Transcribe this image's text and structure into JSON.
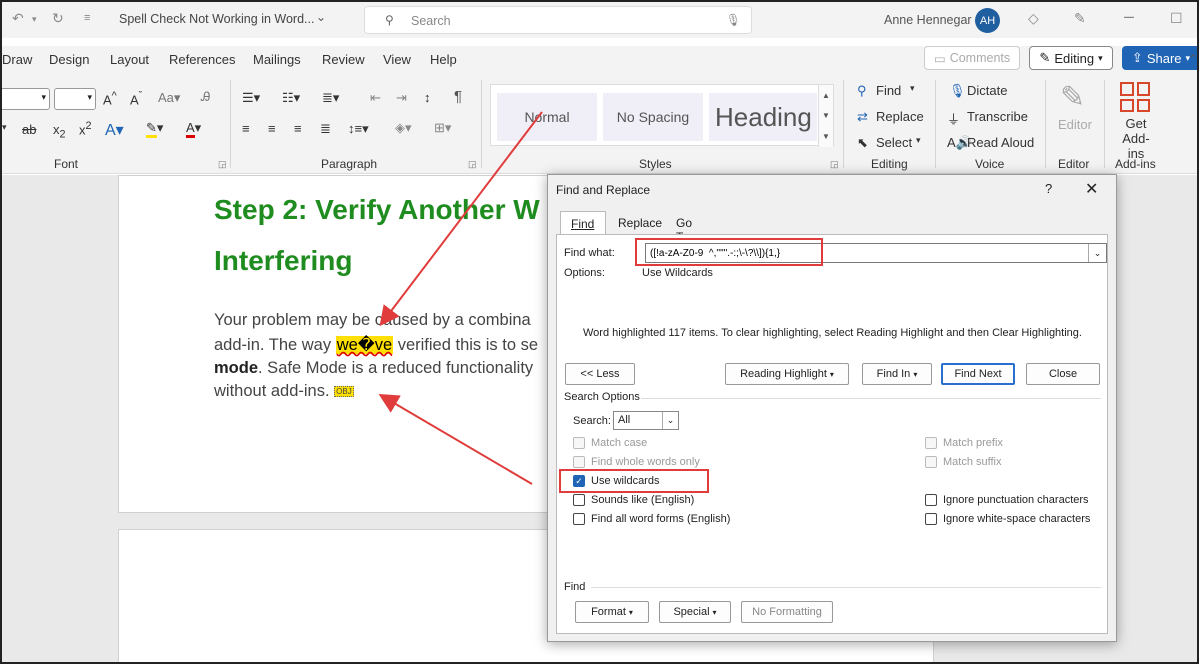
{
  "titlebar": {
    "doc_title": "Spell Check Not Working in Word...",
    "search_placeholder": "Search",
    "user_name": "Anne Hennegar",
    "avatar_initials": "AH"
  },
  "menu": {
    "items": [
      "Draw",
      "Design",
      "Layout",
      "References",
      "Mailings",
      "Review",
      "View",
      "Help"
    ],
    "comments": "Comments",
    "editing": "Editing",
    "share": "Share"
  },
  "ribbon": {
    "groups": {
      "font": "Font",
      "paragraph": "Paragraph",
      "styles": "Styles",
      "editing": "Editing",
      "voice": "Voice",
      "editor": "Editor",
      "addins": "Add-ins"
    },
    "styles": [
      "Normal",
      "No Spacing",
      "Heading"
    ],
    "find": "Find",
    "replace": "Replace",
    "select": "Select",
    "dictate": "Dictate",
    "transcribe": "Transcribe",
    "read_aloud": "Read Aloud",
    "editor_btn": "Editor",
    "get_addins": "Get Add-ins"
  },
  "document": {
    "heading_line1": "Step 2: Verify Another W",
    "heading_line2": "Interfering",
    "p_line1": "Your problem may be caused by a combina",
    "p_line2_a": "add-in. The way ",
    "p_line2_bad": "we�ve",
    "p_line2_b": " verified this is to se",
    "p_line3_bold": "mode",
    "p_line3_rest": ". Safe Mode is a reduced functionality",
    "p_line4": "without add-ins.",
    "obj_label": "OBJ"
  },
  "dialog": {
    "title": "Find and Replace",
    "help": "?",
    "tabs": [
      "Find",
      "Replace",
      "Go To"
    ],
    "find_what_label": "Find what:",
    "find_what_value": "([!a-zA-Z0-9  ^,''\"\".-:;\\-\\?\\\\]){1,}",
    "options_label": "Options:",
    "options_value": "Use Wildcards",
    "message": "Word highlighted 117 items. To clear highlighting, select Reading Highlight and then Clear Highlighting.",
    "buttons": {
      "less": "<< Less",
      "reading_highlight": "Reading Highlight",
      "find_in": "Find In",
      "find_next": "Find Next",
      "close": "Close"
    },
    "search_options_label": "Search Options",
    "search_label": "Search:",
    "search_value": "All",
    "checkboxes": {
      "match_case": "Match case",
      "whole_words": "Find whole words only",
      "use_wildcards": "Use wildcards",
      "sounds_like": "Sounds like (English)",
      "all_word_forms": "Find all word forms (English)",
      "match_prefix": "Match prefix",
      "match_suffix": "Match suffix",
      "ignore_punct": "Ignore punctuation characters",
      "ignore_ws": "Ignore white-space characters"
    },
    "find_section_label": "Find",
    "bottom_buttons": {
      "format": "Format",
      "special": "Special",
      "no_formatting": "No Formatting"
    }
  },
  "colors": {
    "accent": "#1f64b5",
    "heading_green": "#1e8c1e",
    "highlight": "#ffe000",
    "annotation_red": "#e03c3c"
  }
}
